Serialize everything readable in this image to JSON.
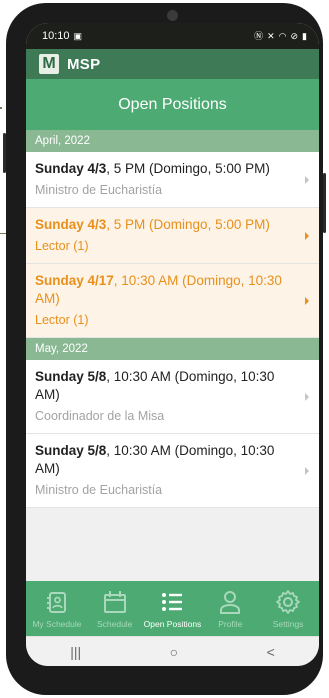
{
  "status_bar": {
    "time": "10:10"
  },
  "app": {
    "logo_letter": "M",
    "name": "MSP"
  },
  "page": {
    "title": "Open Positions"
  },
  "sections": [
    {
      "header": "April, 2022",
      "rows": [
        {
          "day": "Sunday 4/3",
          "time": ", 5 PM (Domingo, 5:00 PM)",
          "role": "Ministro de Eucharistía",
          "highlighted": false
        },
        {
          "day": "Sunday 4/3",
          "time": ", 5 PM (Domingo, 5:00 PM)",
          "role": "Lector (1)",
          "highlighted": true
        },
        {
          "day": "Sunday 4/17",
          "time": ", 10:30 AM (Domingo, 10:30 AM)",
          "role": "Lector (1)",
          "highlighted": true
        }
      ]
    },
    {
      "header": "May, 2022",
      "rows": [
        {
          "day": "Sunday 5/8",
          "time": ", 10:30 AM (Domingo, 10:30 AM)",
          "role": "Coordinador de la Misa",
          "highlighted": false
        },
        {
          "day": "Sunday 5/8",
          "time": ", 10:30 AM (Domingo, 10:30 AM)",
          "role": "Ministro de Eucharistía",
          "highlighted": false
        }
      ]
    }
  ],
  "tabs": [
    {
      "label": "My Schedule",
      "icon": "my-schedule-icon",
      "active": false
    },
    {
      "label": "Schedule",
      "icon": "calendar-icon",
      "active": false
    },
    {
      "label": "Open Positions",
      "icon": "list-icon",
      "active": true
    },
    {
      "label": "Profile",
      "icon": "profile-icon",
      "active": false
    },
    {
      "label": "Settings",
      "icon": "gear-icon",
      "active": false
    }
  ],
  "nav": {
    "recents": "|||",
    "home": "○",
    "back": "<"
  },
  "colors": {
    "app_bar": "#3d7a55",
    "title_bar": "#4caa72",
    "section_header": "#8ab893",
    "highlight_text": "#e8901c",
    "highlight_bg": "#fdf3e7"
  }
}
